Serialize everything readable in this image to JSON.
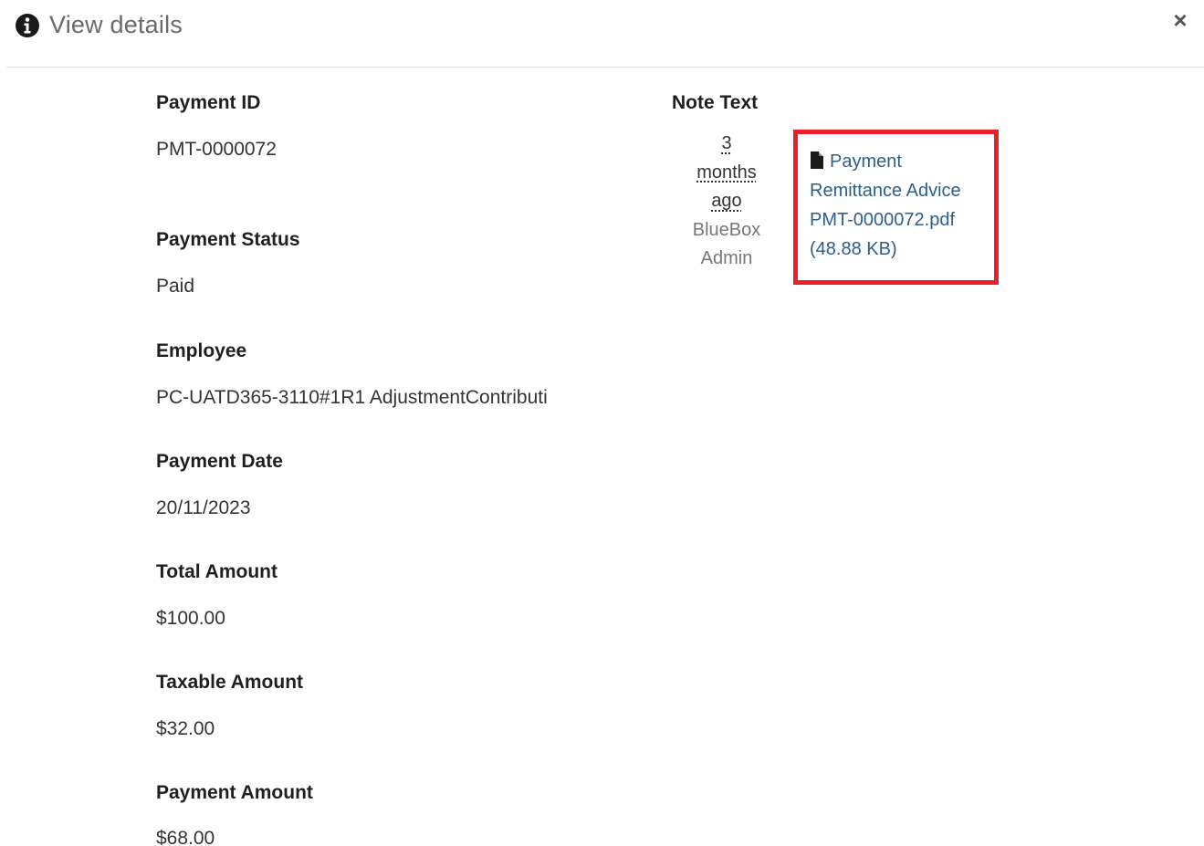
{
  "header": {
    "title": "View details",
    "close_label": "×"
  },
  "fields": [
    {
      "label": "Payment ID",
      "value": "PMT-0000072"
    },
    {
      "label": "Payment Status",
      "value": "Paid"
    },
    {
      "label": "Employee",
      "value": "PC-UATD365-3110#1R1 AdjustmentContributi"
    },
    {
      "label": "Payment Date",
      "value": "20/11/2023"
    },
    {
      "label": "Total Amount",
      "value": "$100.00"
    },
    {
      "label": "Taxable Amount",
      "value": "$32.00"
    },
    {
      "label": "Payment Amount",
      "value": "$68.00"
    }
  ],
  "note": {
    "label": "Note Text",
    "time_ago_line1": "3",
    "time_ago_line2": "months",
    "time_ago_line3": "ago",
    "author_line1": "BlueBox",
    "author_line2": "Admin",
    "attachment": {
      "icon": "file-icon",
      "line1": "Payment",
      "line2": "Remittance Advice",
      "line3": "PMT-0000072.pdf",
      "line4": "(48.88 KB)"
    }
  },
  "colors": {
    "highlight_border": "#e8202a",
    "link": "#2e5e8c"
  }
}
